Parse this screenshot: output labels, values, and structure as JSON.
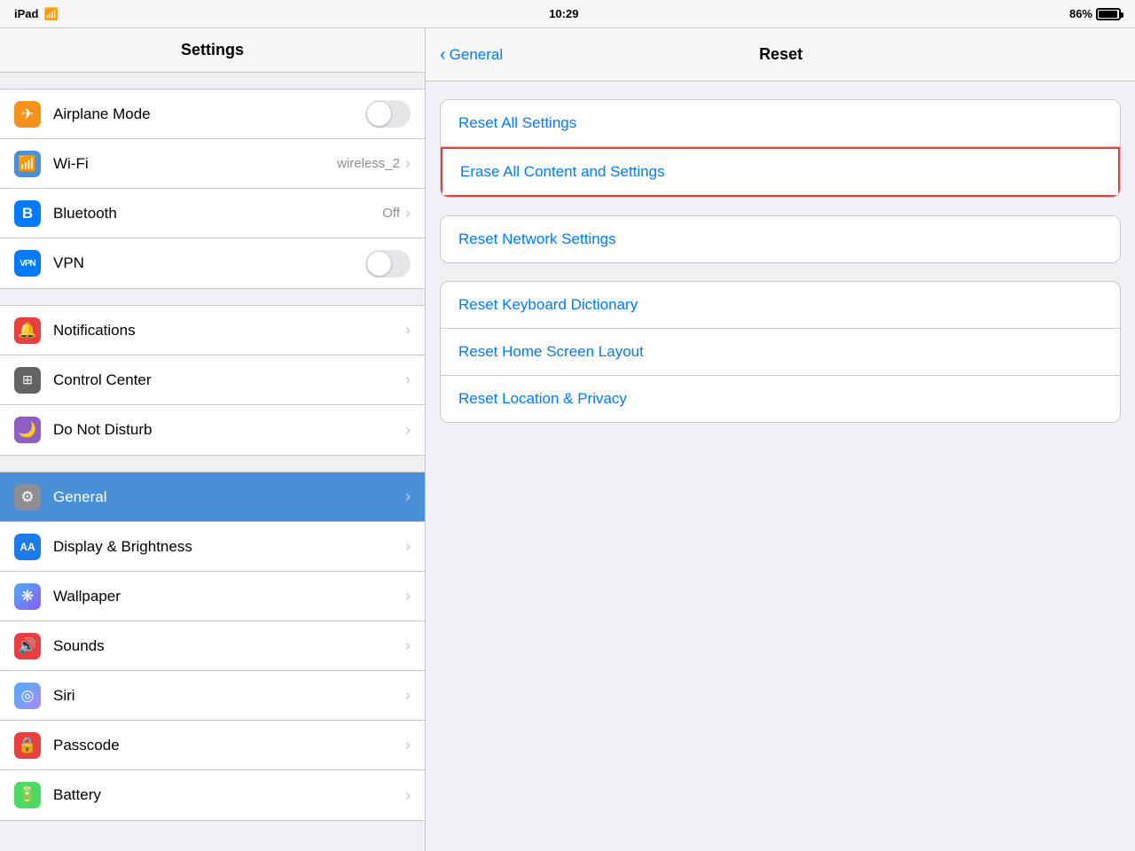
{
  "status": {
    "device": "iPad",
    "wifi_icon": "📶",
    "time": "10:29",
    "battery_percent": "86%"
  },
  "sidebar": {
    "title": "Settings",
    "groups": [
      {
        "id": "connectivity",
        "items": [
          {
            "id": "airplane-mode",
            "label": "Airplane Mode",
            "icon": "✈",
            "icon_class": "icon-orange",
            "control": "toggle",
            "value": ""
          },
          {
            "id": "wifi",
            "label": "Wi-Fi",
            "icon": "📶",
            "icon_class": "icon-blue",
            "control": "value",
            "value": "wireless_2"
          },
          {
            "id": "bluetooth",
            "label": "Bluetooth",
            "icon": "᛫",
            "icon_class": "icon-blue-dark",
            "control": "value",
            "value": "Off"
          },
          {
            "id": "vpn",
            "label": "VPN",
            "icon": "VPN",
            "icon_class": "icon-blue-dark",
            "control": "toggle",
            "value": ""
          }
        ]
      },
      {
        "id": "system1",
        "items": [
          {
            "id": "notifications",
            "label": "Notifications",
            "icon": "🔔",
            "icon_class": "icon-red",
            "control": "none",
            "value": ""
          },
          {
            "id": "control-center",
            "label": "Control Center",
            "icon": "⊞",
            "icon_class": "icon-gray",
            "control": "none",
            "value": ""
          },
          {
            "id": "do-not-disturb",
            "label": "Do Not Disturb",
            "icon": "🌙",
            "icon_class": "icon-purple",
            "control": "none",
            "value": ""
          }
        ]
      },
      {
        "id": "system2",
        "items": [
          {
            "id": "general",
            "label": "General",
            "icon": "⚙",
            "icon_class": "icon-general",
            "control": "none",
            "value": "",
            "active": true
          },
          {
            "id": "display",
            "label": "Display & Brightness",
            "icon": "AA",
            "icon_class": "icon-blue-aa",
            "control": "none",
            "value": ""
          },
          {
            "id": "wallpaper",
            "label": "Wallpaper",
            "icon": "❋",
            "icon_class": "icon-wallpaper",
            "control": "none",
            "value": ""
          },
          {
            "id": "sounds",
            "label": "Sounds",
            "icon": "🔊",
            "icon_class": "icon-sounds",
            "control": "none",
            "value": ""
          },
          {
            "id": "siri",
            "label": "Siri",
            "icon": "◎",
            "icon_class": "icon-siri",
            "control": "none",
            "value": ""
          },
          {
            "id": "passcode",
            "label": "Passcode",
            "icon": "🔒",
            "icon_class": "icon-passcode",
            "control": "none",
            "value": ""
          },
          {
            "id": "battery",
            "label": "Battery",
            "icon": "🔋",
            "icon_class": "icon-battery",
            "control": "none",
            "value": ""
          }
        ]
      }
    ]
  },
  "right_panel": {
    "back_label": "General",
    "title": "Reset",
    "groups": [
      {
        "id": "group1",
        "items": [
          {
            "id": "reset-all-settings",
            "label": "Reset All Settings",
            "highlighted": false
          },
          {
            "id": "erase-all-content",
            "label": "Erase All Content and Settings",
            "highlighted": true
          }
        ]
      },
      {
        "id": "group2",
        "items": [
          {
            "id": "reset-network",
            "label": "Reset Network Settings",
            "highlighted": false
          }
        ]
      },
      {
        "id": "group3",
        "items": [
          {
            "id": "reset-keyboard",
            "label": "Reset Keyboard Dictionary",
            "highlighted": false
          },
          {
            "id": "reset-home-screen",
            "label": "Reset Home Screen Layout",
            "highlighted": false
          },
          {
            "id": "reset-location",
            "label": "Reset Location & Privacy",
            "highlighted": false
          }
        ]
      }
    ]
  }
}
